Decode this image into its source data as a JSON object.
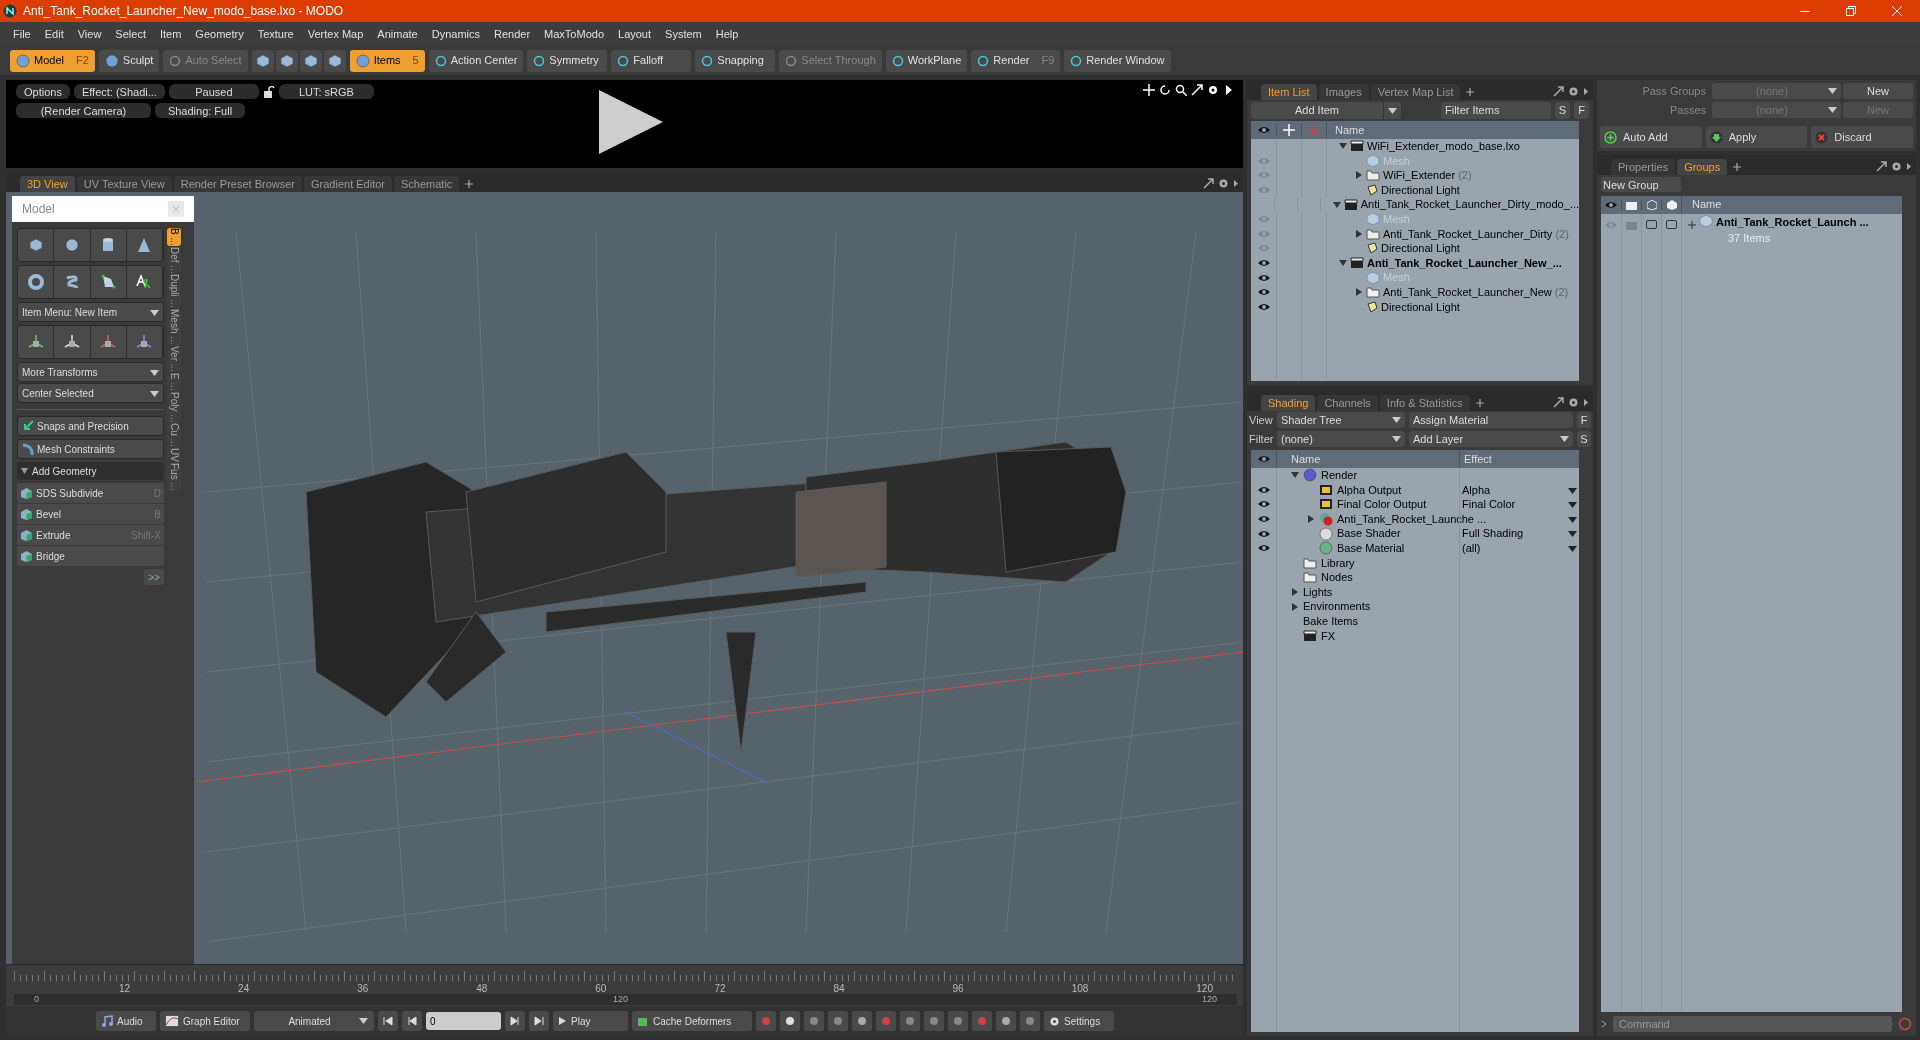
{
  "window": {
    "title": "Anti_Tank_Rocket_Launcher_New_modo_base.lxo - MODO"
  },
  "menu": [
    "File",
    "Edit",
    "View",
    "Select",
    "Item",
    "Geometry",
    "Texture",
    "Vertex Map",
    "Animate",
    "Dynamics",
    "Render",
    "MaxToModo",
    "Layout",
    "System",
    "Help"
  ],
  "toolbar": [
    {
      "kind": "mode",
      "label": "Model",
      "shortcut": "F2",
      "selected": true,
      "disabled": false
    },
    {
      "kind": "mode",
      "label": "Sculpt",
      "selected": false,
      "disabled": false
    },
    {
      "kind": "button",
      "label": "Auto Select",
      "selected": false,
      "disabled": true
    },
    {
      "kind": "icons"
    },
    {
      "kind": "mode",
      "label": "Items",
      "shortcut": "5",
      "selected": true,
      "disabled": false
    },
    {
      "kind": "button",
      "label": "Action Center",
      "selected": false,
      "disabled": false
    },
    {
      "kind": "button",
      "label": "Symmetry",
      "selected": false,
      "disabled": false
    },
    {
      "kind": "button",
      "label": "Falloff",
      "selected": false,
      "disabled": false
    },
    {
      "kind": "button",
      "label": "Snapping",
      "selected": false,
      "disabled": false
    },
    {
      "kind": "button",
      "label": "Select Through",
      "selected": false,
      "disabled": true
    },
    {
      "kind": "button",
      "label": "WorkPlane",
      "selected": false,
      "disabled": false
    },
    {
      "kind": "button",
      "label": "Render",
      "shortcut": "F9",
      "selected": false,
      "disabled": false
    },
    {
      "kind": "button",
      "label": "Render Window",
      "selected": false,
      "disabled": false
    }
  ],
  "preview": {
    "row1": [
      "Options",
      "Effect: (Shadi...",
      "Paused"
    ],
    "lut": "LUT: sRGB",
    "row2": [
      "(Render Camera)",
      "Shading: Full"
    ]
  },
  "viewport_tabs": [
    {
      "label": "3D View",
      "selected": true
    },
    {
      "label": "UV Texture View",
      "selected": false
    },
    {
      "label": "Render Preset Browser",
      "selected": false
    },
    {
      "label": "Gradient Editor",
      "selected": false
    },
    {
      "label": "Schematic",
      "selected": false
    }
  ],
  "model_panel": {
    "title": "Model",
    "dropdowns": [
      "Item Menu: New Item"
    ],
    "transform_dropdowns": [
      "More Transforms",
      "Center Selected"
    ],
    "tools": [
      "Snaps and Precision",
      "Mesh Constraints"
    ],
    "section": "Add Geometry",
    "geometry": [
      {
        "label": "SDS Subdivide",
        "shortcut": "D"
      },
      {
        "label": "Bevel",
        "shortcut": "B"
      },
      {
        "label": "Extrude",
        "shortcut": "Shift-X"
      },
      {
        "label": "Bridge"
      }
    ],
    "more": ">>",
    "side_tabs": [
      {
        "label": "B ...",
        "selected": true
      },
      {
        "label": "Def ...",
        "selected": false
      },
      {
        "label": "Dupli ...",
        "selected": false
      },
      {
        "label": "Mesh ...",
        "selected": false
      },
      {
        "label": "Ver ...",
        "selected": false
      },
      {
        "label": "E ...",
        "selected": false
      },
      {
        "label": "Poly ...",
        "selected": false
      },
      {
        "label": "Cu ...",
        "selected": false
      },
      {
        "label": "UV",
        "selected": false
      },
      {
        "label": "Fus ...",
        "selected": false
      }
    ]
  },
  "timeline": {
    "ticks": [
      "12",
      "24",
      "36",
      "48",
      "60",
      "72",
      "84",
      "96",
      "108",
      "120"
    ],
    "range": [
      "0",
      "120",
      "120"
    ]
  },
  "bottom_bar": {
    "audio": "Audio",
    "graph_editor": "Graph Editor",
    "mode": "Animated",
    "frame": "0",
    "play": "Play",
    "cache": "Cache Deformers",
    "settings": "Settings"
  },
  "item_list": {
    "tabs": [
      {
        "label": "Item List",
        "selected": true
      },
      {
        "label": "Images",
        "selected": false
      },
      {
        "label": "Vertex Map List",
        "selected": false
      }
    ],
    "add_item": "Add Item",
    "filter": "Filter Items",
    "buttons": [
      "S",
      "F"
    ],
    "column": "Name",
    "items": [
      {
        "name": "WiFi_Extender_modo_base.lxo",
        "kind": "scene",
        "visible": false,
        "selected": false,
        "expanded": true,
        "children": [
          {
            "name": "Mesh",
            "kind": "mesh",
            "visible": false,
            "selected": false
          },
          {
            "name": "WiFi_Extender",
            "count": "(2)",
            "kind": "group",
            "visible": false,
            "selected": false,
            "expanded": false
          },
          {
            "name": "Directional Light",
            "kind": "light",
            "visible": false,
            "selected": false
          }
        ]
      },
      {
        "name": "Anti_Tank_Rocket_Launcher_Dirty_modo_...",
        "kind": "scene",
        "visible": false,
        "selected": false,
        "expanded": true,
        "children": [
          {
            "name": "Mesh",
            "kind": "mesh",
            "visible": false,
            "selected": false
          },
          {
            "name": "Anti_Tank_Rocket_Launcher_Dirty",
            "count": "(2)",
            "kind": "group",
            "visible": false,
            "selected": false,
            "expanded": false
          },
          {
            "name": "Directional Light",
            "kind": "light",
            "visible": false,
            "selected": false
          }
        ]
      },
      {
        "name": "Anti_Tank_Rocket_Launcher_New_...",
        "kind": "scene",
        "visible": true,
        "selected": true,
        "expanded": true,
        "children": [
          {
            "name": "Mesh",
            "kind": "mesh",
            "visible": true,
            "selected": false
          },
          {
            "name": "Anti_Tank_Rocket_Launcher_New",
            "count": "(2)",
            "kind": "group",
            "visible": true,
            "selected": false,
            "expanded": false
          },
          {
            "name": "Directional Light",
            "kind": "light",
            "visible": true,
            "selected": false
          }
        ]
      }
    ]
  },
  "shading": {
    "tabs": [
      {
        "label": "Shading",
        "selected": true
      },
      {
        "label": "Channels",
        "selected": false
      },
      {
        "label": "Info & Statistics",
        "selected": false
      }
    ],
    "view_label": "View",
    "view": "Shader Tree",
    "assign": "Assign Material",
    "filter_label": "Filter",
    "filter": "(none)",
    "add_layer": "Add Layer",
    "buttons": [
      "F",
      "S"
    ],
    "columns": [
      "Name",
      "Effect"
    ],
    "items": [
      {
        "name": "Render",
        "kind": "render",
        "visible": false,
        "expanded": true,
        "children": [
          {
            "name": "Alpha Output",
            "effect": "Alpha",
            "kind": "output",
            "visible": true
          },
          {
            "name": "Final Color Output",
            "effect": "Final Color",
            "kind": "output",
            "visible": true
          },
          {
            "name": "Anti_Tank_Rocket_Launche ...",
            "kind": "material-group",
            "visible": true,
            "expanded": false
          },
          {
            "name": "Base Shader",
            "effect": "Full Shading",
            "kind": "shader",
            "visible": true
          },
          {
            "name": "Base Material",
            "effect": "(all)",
            "kind": "material",
            "visible": true
          }
        ]
      },
      {
        "name": "Library",
        "kind": "folder",
        "visible": false
      },
      {
        "name": "Nodes",
        "kind": "folder",
        "visible": false
      },
      {
        "name": "Lights",
        "kind": "category",
        "visible": false,
        "expanded": false
      },
      {
        "name": "Environments",
        "kind": "category",
        "visible": false,
        "expanded": false
      },
      {
        "name": "Bake Items",
        "kind": "category",
        "visible": false
      },
      {
        "name": "FX",
        "kind": "scene",
        "visible": false
      }
    ]
  },
  "passes": {
    "rows": [
      {
        "label": "Pass Groups",
        "value": "(none)",
        "button": "New",
        "disabled": false
      },
      {
        "label": "Passes",
        "value": "(none)",
        "button": "New",
        "disabled": true
      }
    ],
    "actions": [
      "Auto Add",
      "Apply",
      "Discard"
    ]
  },
  "groups": {
    "tabs": [
      {
        "label": "Properties",
        "selected": false
      },
      {
        "label": "Groups",
        "selected": true
      }
    ],
    "new_group": "New Group",
    "column": "Name",
    "rows": [
      {
        "name": "Anti_Tank_Rocket_Launch ...",
        "count": "37 Items",
        "toggles": [
          {
            "checked": false
          },
          {
            "checked": false
          }
        ]
      }
    ]
  },
  "command": {
    "placeholder": "Command"
  }
}
